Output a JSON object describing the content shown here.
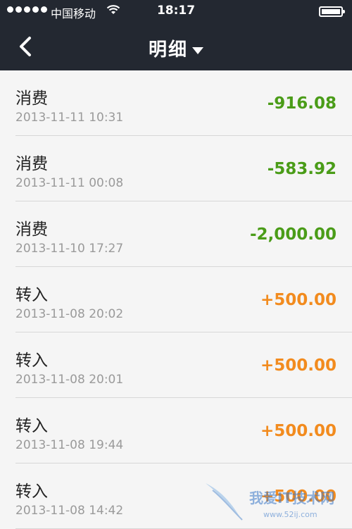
{
  "status_bar": {
    "carrier": "中国移动",
    "time": "18:17"
  },
  "nav": {
    "title": "明细"
  },
  "colors": {
    "expense": "#4a9c18",
    "income": "#f28b1e",
    "header_bg": "#232831"
  },
  "transactions": [
    {
      "type": "消费",
      "date": "2013-11-11 10:31",
      "amount": "-916.08",
      "kind": "expense"
    },
    {
      "type": "消费",
      "date": "2013-11-11 00:08",
      "amount": "-583.92",
      "kind": "expense"
    },
    {
      "type": "消费",
      "date": "2013-11-10 17:27",
      "amount": "-2,000.00",
      "kind": "expense"
    },
    {
      "type": "转入",
      "date": "2013-11-08 20:02",
      "amount": "+500.00",
      "kind": "income"
    },
    {
      "type": "转入",
      "date": "2013-11-08 20:01",
      "amount": "+500.00",
      "kind": "income"
    },
    {
      "type": "转入",
      "date": "2013-11-08 19:44",
      "amount": "+500.00",
      "kind": "income"
    },
    {
      "type": "转入",
      "date": "2013-11-08 14:42",
      "amount": "+500.00",
      "kind": "income"
    }
  ],
  "watermark": {
    "text": "我爱IT技术网",
    "subtext": "www.52ij.com"
  }
}
